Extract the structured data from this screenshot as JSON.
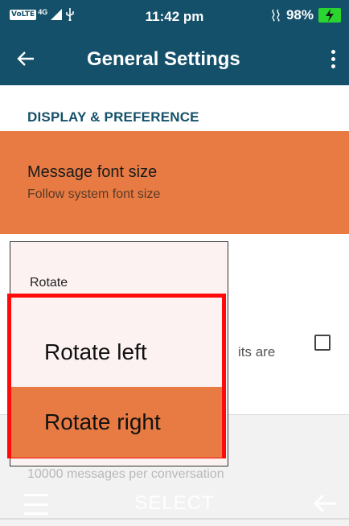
{
  "status_bar": {
    "volte": "VoLTE",
    "network": "4G",
    "time": "11:42 pm",
    "battery": "98%",
    "colors": {
      "background": "#14506a",
      "battery": "#2ad52f"
    }
  },
  "toolbar": {
    "back_icon": "arrow-left-icon",
    "title": "General Settings",
    "menu_icon": "more-vert-icon"
  },
  "section": {
    "header": "DISPLAY & PREFERENCE"
  },
  "font_size_pref": {
    "title": "Message font size",
    "summary": "Follow system font size"
  },
  "rotate_dialog": {
    "title": "Rotate",
    "options": [
      {
        "label": "Rotate left",
        "selected": false
      },
      {
        "label": "Rotate right",
        "selected": true
      }
    ]
  },
  "hidden_pref": {
    "partial_text": "its are",
    "checked": false
  },
  "message_limit": {
    "summary": "10000 messages per conversation"
  },
  "softkeys": {
    "left_icon": "hamburger-menu-icon",
    "center": "SELECT",
    "right_icon": "back-arrow-icon"
  },
  "colors": {
    "primary": "#14506a",
    "accent": "#e77b43",
    "focus_frame": "#ff0a0a"
  }
}
